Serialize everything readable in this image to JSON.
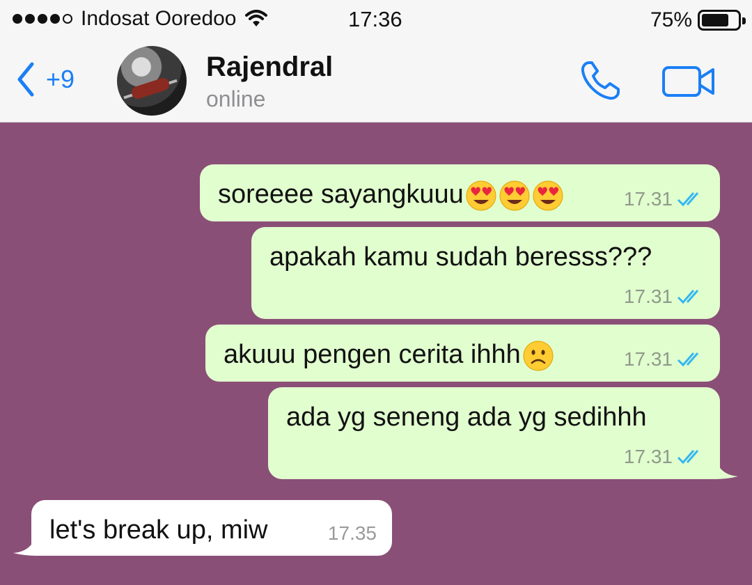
{
  "status_bar": {
    "carrier": "Indosat Ooredoo",
    "time": "17:36",
    "battery": "75%",
    "battery_level": 0.75
  },
  "header": {
    "back_count": "+9",
    "contact_name": "Rajendral",
    "contact_status": "online",
    "accent_color": "#1a7ff5"
  },
  "chat": {
    "background_color": "#8a4f77",
    "messages": [
      {
        "direction": "outgoing",
        "text": "soreeee sayangkuuu",
        "emoji": [
          "heart-eyes",
          "heart-eyes",
          "heart-eyes"
        ],
        "time": "17.31",
        "status": "read"
      },
      {
        "direction": "outgoing",
        "text": "apakah kamu sudah beresss???",
        "time": "17.31",
        "status": "read"
      },
      {
        "direction": "outgoing",
        "text": "akuuu pengen cerita ihhh",
        "emoji": [
          "frowning"
        ],
        "time": "17.31",
        "status": "read"
      },
      {
        "direction": "outgoing",
        "text": "ada yg seneng ada yg sedihhh",
        "time": "17.31",
        "status": "read"
      },
      {
        "direction": "incoming",
        "text": "let's break up, miw",
        "time": "17.35"
      }
    ]
  }
}
